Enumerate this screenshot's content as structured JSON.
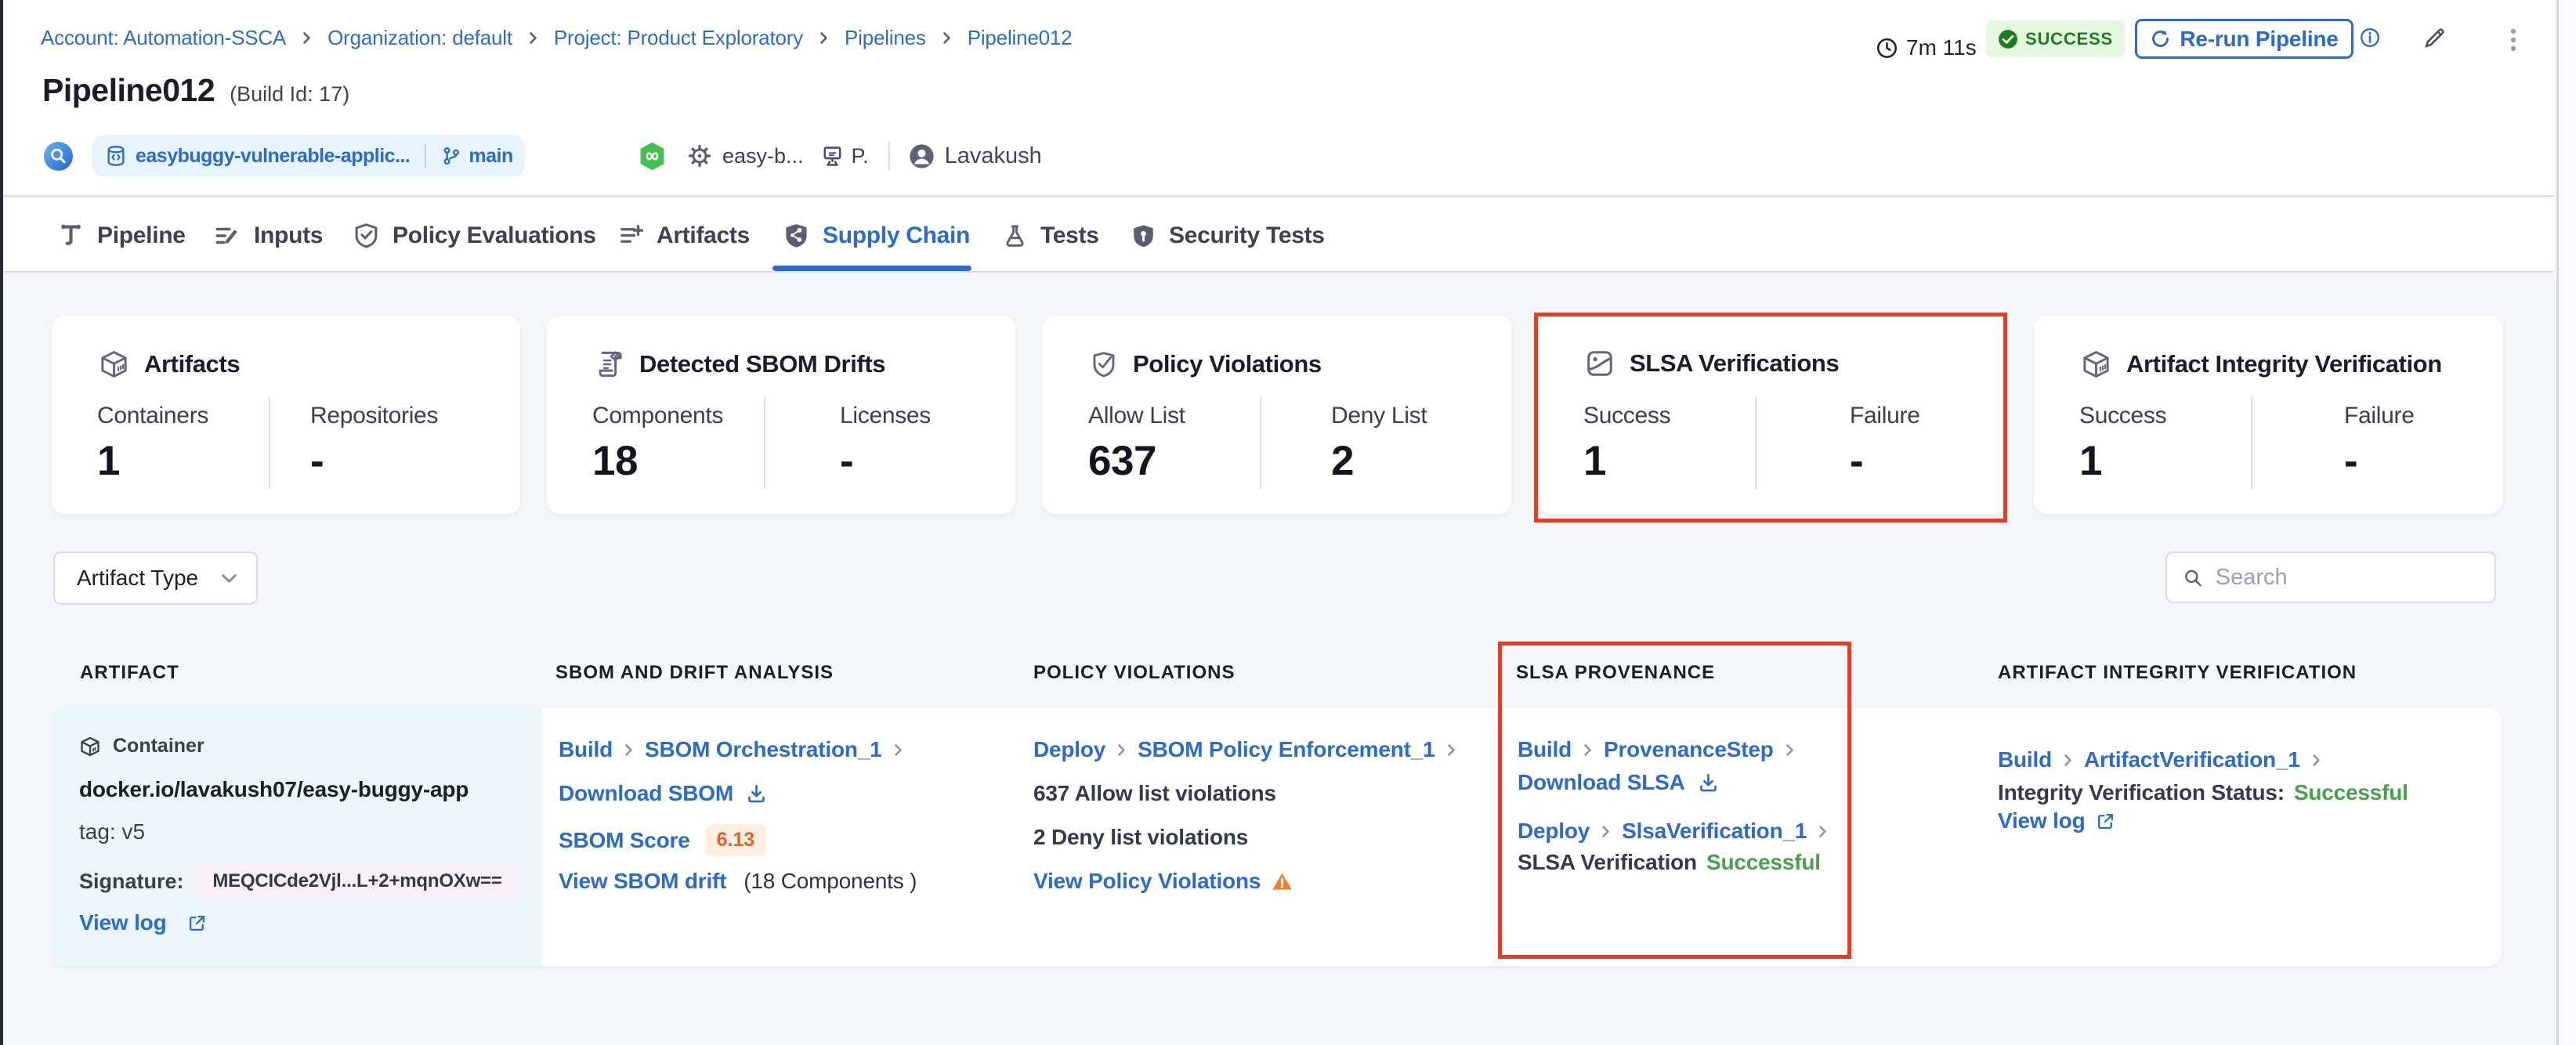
{
  "breadcrumbs": {
    "items": [
      {
        "label": "Account: Automation-SSCA"
      },
      {
        "label": "Organization: default"
      },
      {
        "label": "Project: Product Exploratory"
      },
      {
        "label": "Pipelines"
      },
      {
        "label": "Pipeline012"
      }
    ]
  },
  "header": {
    "title": "Pipeline012",
    "build_id": "(Build Id: 17)",
    "repo_chip": {
      "repo": "easybuggy-vulnerable-applic...",
      "branch": "main"
    },
    "pipeline_short": "easy-b...",
    "delegate_short": "P.",
    "user": "Lavakush",
    "duration": "7m 11s",
    "status": "SUCCESS",
    "rerun_label": "Re-run Pipeline"
  },
  "tabs": {
    "items": [
      {
        "label": "Pipeline",
        "active": false
      },
      {
        "label": "Inputs",
        "active": false
      },
      {
        "label": "Policy Evaluations",
        "active": false
      },
      {
        "label": "Artifacts",
        "active": false
      },
      {
        "label": "Supply Chain",
        "active": true
      },
      {
        "label": "Tests",
        "active": false
      },
      {
        "label": "Security Tests",
        "active": false
      }
    ]
  },
  "cards": [
    {
      "title": "Artifacts",
      "col1_label": "Containers",
      "col1_value": "1",
      "col2_label": "Repositories",
      "col2_value": "-"
    },
    {
      "title": "Detected SBOM Drifts",
      "col1_label": "Components",
      "col1_value": "18",
      "col2_label": "Licenses",
      "col2_value": "-"
    },
    {
      "title": "Policy Violations",
      "col1_label": "Allow List",
      "col1_value": "637",
      "col2_label": "Deny List",
      "col2_value": "2"
    },
    {
      "title": "SLSA Verifications",
      "col1_label": "Success",
      "col1_value": "1",
      "col2_label": "Failure",
      "col2_value": "-"
    },
    {
      "title": "Artifact Integrity Verification",
      "col1_label": "Success",
      "col1_value": "1",
      "col2_label": "Failure",
      "col2_value": "-"
    }
  ],
  "filters": {
    "artifact_type_label": "Artifact Type",
    "search_placeholder": "Search"
  },
  "table": {
    "headers": [
      "ARTIFACT",
      "SBOM AND DRIFT ANALYSIS",
      "POLICY VIOLATIONS",
      "SLSA PROVENANCE",
      "ARTIFACT INTEGRITY VERIFICATION"
    ],
    "artifact": {
      "type": "Container",
      "image": "docker.io/lavakush07/easy-buggy-app",
      "tag": "tag: v5",
      "signature_label": "Signature:",
      "signature_value": "MEQCICde2Vjl...L+2+mqnOXw==",
      "view_log": "View log"
    },
    "sbom": {
      "stage": "Build",
      "step": "SBOM Orchestration_1",
      "download": "Download SBOM",
      "score_label": "SBOM Score",
      "score_value": "6.13",
      "drift_link": "View SBOM drift",
      "drift_note": "(18 Components )"
    },
    "policy": {
      "stage": "Deploy",
      "step": "SBOM Policy Enforcement_1",
      "allow": "637 Allow list violations",
      "deny": "2 Deny list violations",
      "view_link": "View Policy Violations"
    },
    "slsa": {
      "stage1": "Build",
      "step1": "ProvenanceStep",
      "download": "Download SLSA",
      "stage2": "Deploy",
      "step2": "SlsaVerification_1",
      "status_label": "SLSA Verification",
      "status_value": "Successful"
    },
    "integrity": {
      "stage": "Build",
      "step": "ArtifactVerification_1",
      "status_label": "Integrity Verification Status:",
      "status_value": "Successful",
      "view_log": "View log"
    }
  },
  "colors": {
    "link_blue": "#2b6bce",
    "success_green": "#48a14a",
    "badge_green_bg": "#e4f7df",
    "badge_green_text": "#1e7d1e",
    "annotation_red": "#e83c20",
    "score_orange": "#dd6327"
  }
}
